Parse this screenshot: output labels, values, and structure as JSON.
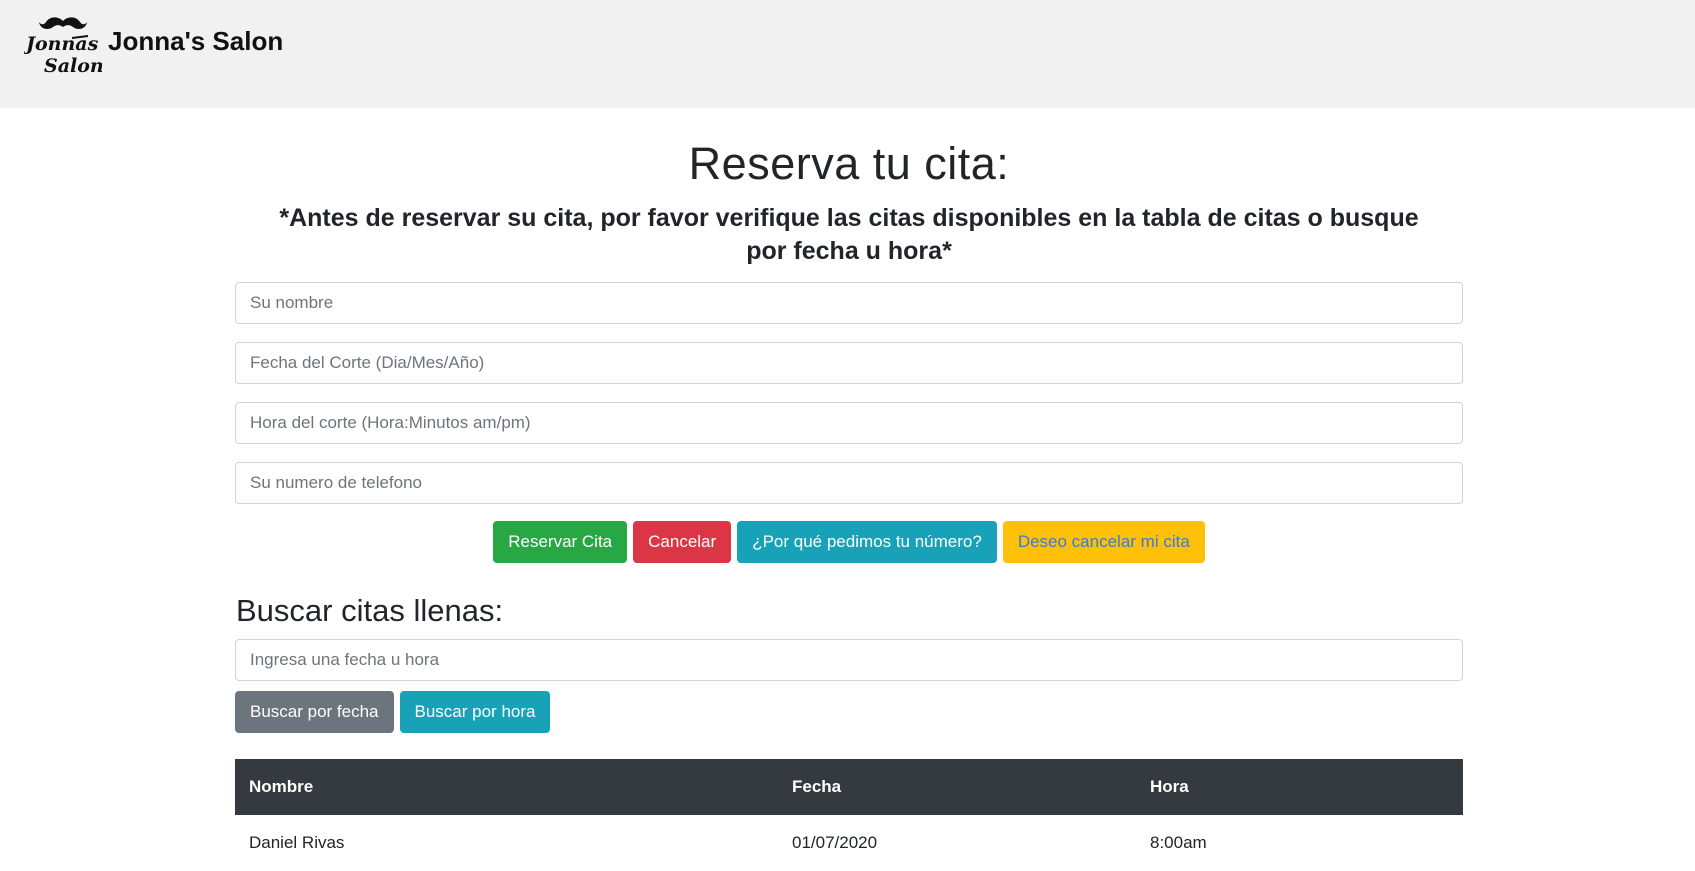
{
  "brand": {
    "name": "Jonna's Salon",
    "logo_text": "Jonnas Salon"
  },
  "page": {
    "title": "Reserva tu cita:",
    "subtitle": "*Antes de reservar su cita, por favor verifique las citas disponibles en la tabla de citas o busque por fecha u hora*"
  },
  "form": {
    "name_placeholder": "Su nombre",
    "date_placeholder": "Fecha del Corte (Dia/Mes/Año)",
    "time_placeholder": "Hora del corte (Hora:Minutos am/pm)",
    "phone_placeholder": "Su numero de telefono",
    "reserve_label": "Reservar Cita",
    "cancel_label": "Cancelar",
    "why_number_label": "¿Por qué pedimos tu número?",
    "cancel_appt_label": "Deseo cancelar mi cita"
  },
  "search": {
    "title": "Buscar citas llenas:",
    "placeholder": "Ingresa una fecha u hora",
    "by_date_label": "Buscar por fecha",
    "by_time_label": "Buscar por hora"
  },
  "table": {
    "headers": [
      "Nombre",
      "Fecha",
      "Hora"
    ],
    "rows": [
      [
        "Daniel Rivas",
        "01/07/2020",
        "8:00am"
      ]
    ]
  },
  "colors": {
    "success": "#28a745",
    "danger": "#dc3545",
    "info": "#17a2b8",
    "warning": "#ffc107",
    "secondary": "#6c757d",
    "table_header": "#343a40"
  }
}
